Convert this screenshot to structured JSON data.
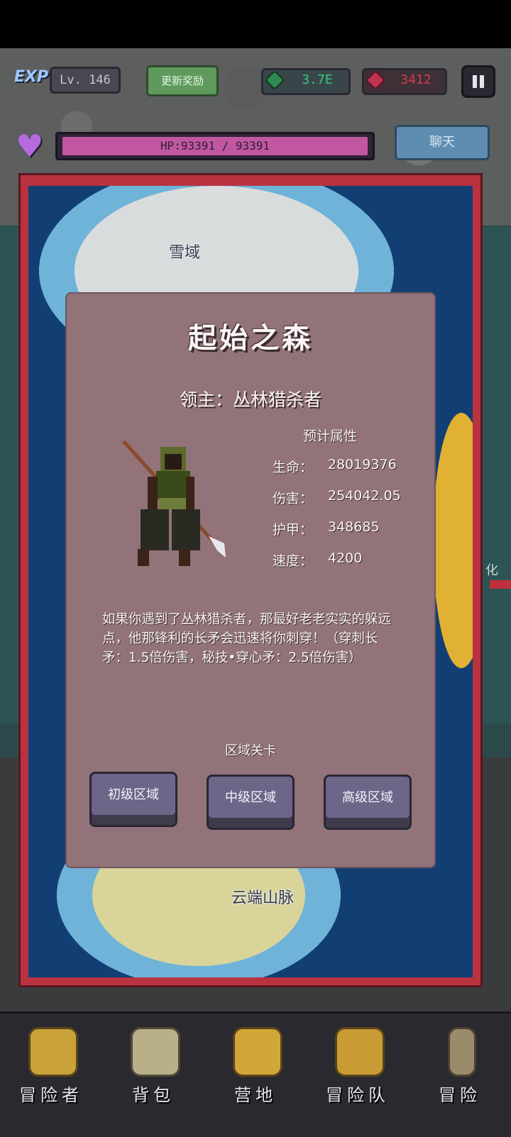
{
  "hud": {
    "exp_badge": "EXP",
    "level": "Lv. 146",
    "update_reward": "更新奖励",
    "gems": "3.7E",
    "rubies": "3412",
    "hp": "HP:93391 / 93391",
    "hp_fraction": 1.0,
    "chat": "聊天"
  },
  "map": {
    "regions": [
      "雪域",
      "云端山脉"
    ],
    "side_label": "化"
  },
  "modal": {
    "title": "起始之森",
    "boss": "领主：丛林猎杀者",
    "stats_header": "预计属性",
    "stats": [
      {
        "label": "生命：",
        "value": "28019376"
      },
      {
        "label": "伤害：",
        "value": "254042.05"
      },
      {
        "label": "护甲：",
        "value": "348685"
      },
      {
        "label": "速度：",
        "value": "4200"
      }
    ],
    "description": "如果你遇到了丛林猎杀者，那最好老老实实的躲远点，他那锋利的长矛会迅速将你刺穿！（穿刺长矛：1.5倍伤害，秘技•穿心矛：2.5倍伤害）",
    "zone_header": "区域关卡",
    "zones": [
      "初级区域",
      "中级区域",
      "高级区域"
    ]
  },
  "nav": [
    {
      "label": "冒险者",
      "icon": "helmet-icon"
    },
    {
      "label": "背包",
      "icon": "backpack-icon"
    },
    {
      "label": "营地",
      "icon": "camp-banner-icon"
    },
    {
      "label": "冒险队",
      "icon": "guild-book-icon"
    },
    {
      "label": "冒险",
      "icon": "sword-icon"
    }
  ],
  "colors": {
    "modal_bg": "#917379",
    "map_frame": "#b8333f",
    "hp_fill": "#c157a0",
    "chat_button": "#5e8db1",
    "update_button": "#5e9a5c"
  }
}
